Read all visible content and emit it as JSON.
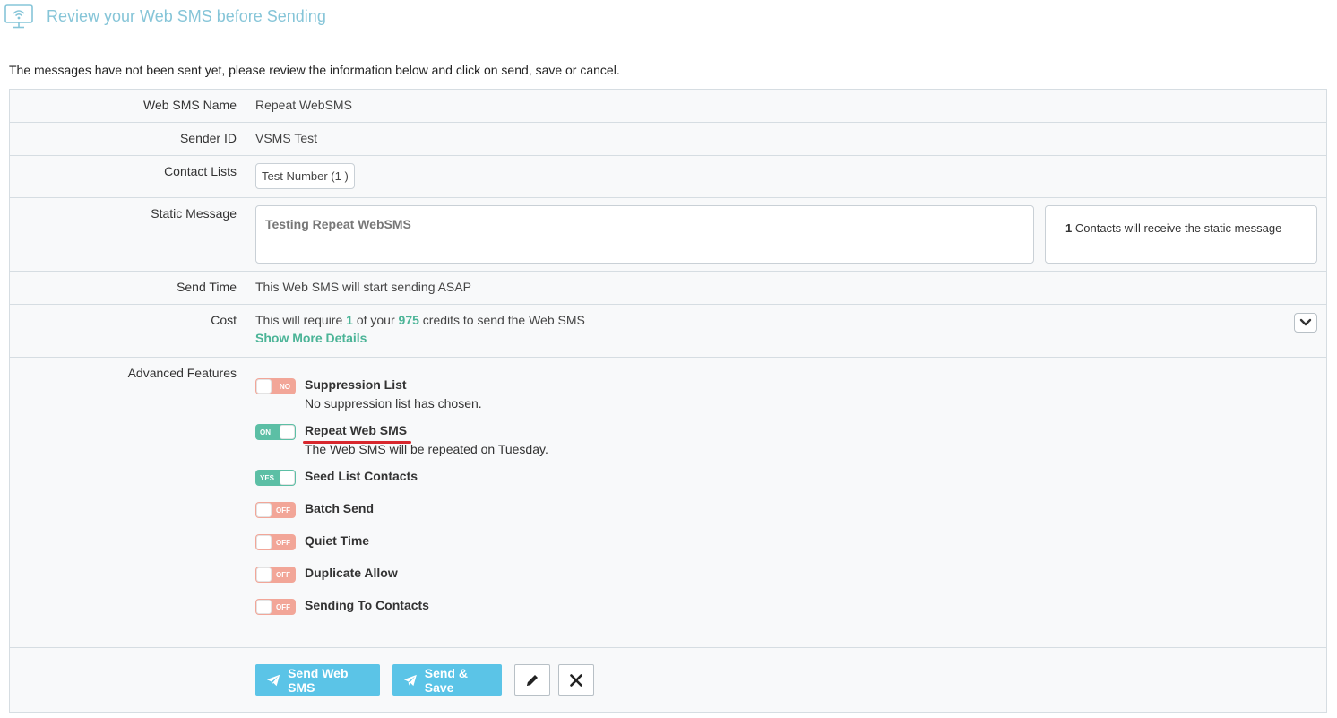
{
  "header": {
    "title": "Review your Web SMS before Sending",
    "icon": "broadcast-monitor-icon"
  },
  "notice": "The messages have not been sent yet, please review the information below and click on send, save or cancel.",
  "rows": {
    "name": {
      "label": "Web SMS Name",
      "value": "Repeat WebSMS"
    },
    "sender": {
      "label": "Sender ID",
      "value": "VSMS Test"
    },
    "contacts": {
      "label": "Contact Lists",
      "tag": "Test Number (1 )"
    },
    "static": {
      "label": "Static Message",
      "message": "Testing Repeat WebSMS",
      "recipients_count": "1",
      "recipients_text": "Contacts will receive the static message"
    },
    "time": {
      "label": "Send Time",
      "value": "This Web SMS will start sending ASAP"
    },
    "cost": {
      "label": "Cost",
      "prefix": "This will require",
      "credits_required": "1",
      "middle": "of your",
      "credits_available": "975",
      "suffix": "credits to send the Web SMS",
      "show_more": "Show More Details"
    },
    "advanced": {
      "label": "Advanced Features",
      "features": [
        {
          "name": "Suppression List",
          "state": "NO",
          "on": false,
          "desc": "No suppression list has chosen."
        },
        {
          "name": "Repeat Web SMS",
          "state": "ON",
          "on": true,
          "desc": "The Web SMS will be repeated on Tuesday."
        },
        {
          "name": "Seed List Contacts",
          "state": "YES",
          "on": true,
          "desc": ""
        },
        {
          "name": "Batch Send",
          "state": "OFF",
          "on": false,
          "desc": ""
        },
        {
          "name": "Quiet Time",
          "state": "OFF",
          "on": false,
          "desc": ""
        },
        {
          "name": "Duplicate Allow",
          "state": "OFF",
          "on": false,
          "desc": ""
        },
        {
          "name": "Sending To Contacts",
          "state": "OFF",
          "on": false,
          "desc": ""
        }
      ]
    }
  },
  "actions": {
    "send": "Send Web SMS",
    "send_save": "Send & Save"
  },
  "colors": {
    "accent": "#5bc4e7",
    "green": "#4bb497",
    "toggle_off": "#f2a698",
    "toggle_on": "#5cbfa5",
    "title": "#86c5d8",
    "highlight": "#d8272d"
  }
}
